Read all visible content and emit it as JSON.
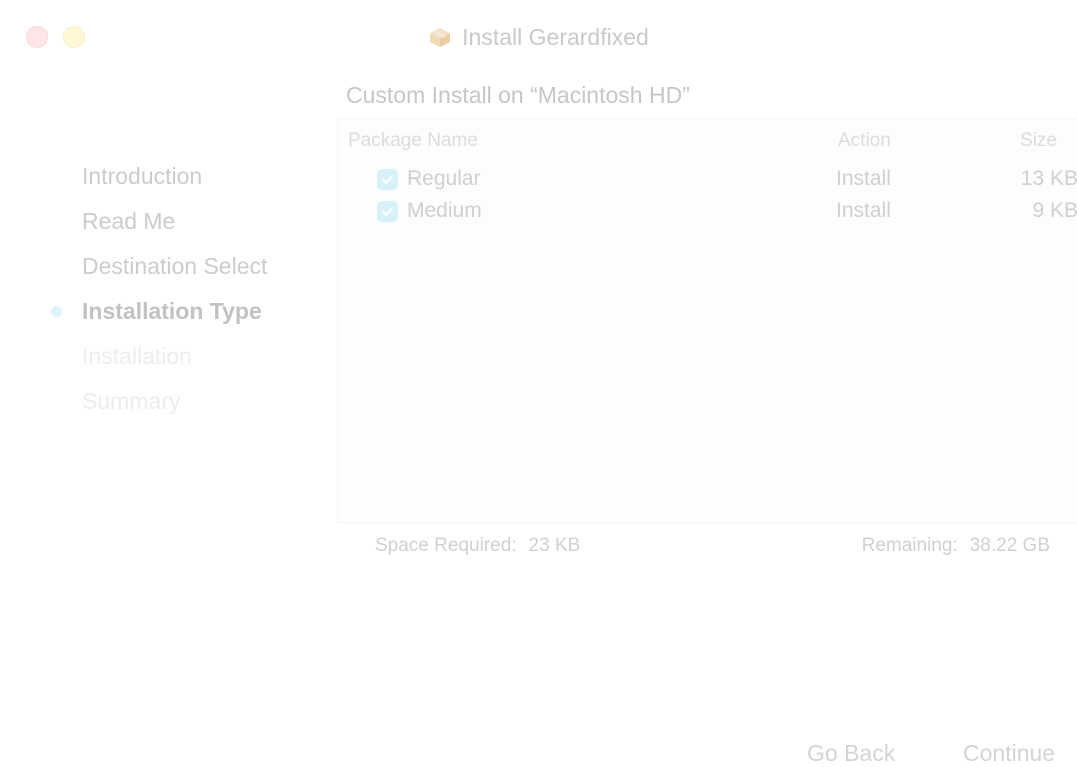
{
  "window": {
    "title": "Install Gerardfixed",
    "title_icon": "package-icon"
  },
  "sidebar": {
    "items": [
      {
        "label": "Introduction",
        "state": "done"
      },
      {
        "label": "Read Me",
        "state": "done"
      },
      {
        "label": "Destination Select",
        "state": "done"
      },
      {
        "label": "Installation Type",
        "state": "active"
      },
      {
        "label": "Installation",
        "state": "future"
      },
      {
        "label": "Summary",
        "state": "future"
      }
    ]
  },
  "main": {
    "heading": "Custom Install on “Macintosh HD”",
    "table": {
      "columns": {
        "name": "Package Name",
        "action": "Action",
        "size": "Size"
      },
      "rows": [
        {
          "checked": true,
          "name": "Regular",
          "action": "Install",
          "size": "13 KB"
        },
        {
          "checked": true,
          "name": "Medium",
          "action": "Install",
          "size": "9 KB"
        }
      ]
    },
    "space_required": {
      "label": "Space Required:",
      "value": "23 KB"
    },
    "remaining": {
      "label": "Remaining:",
      "value": "38.22 GB"
    }
  },
  "buttons": {
    "go_back": "Go Back",
    "continue": "Continue"
  },
  "colors": {
    "accent": "#ddf4fb",
    "close": "#ffe6e6",
    "minimize": "#fff8d6"
  }
}
